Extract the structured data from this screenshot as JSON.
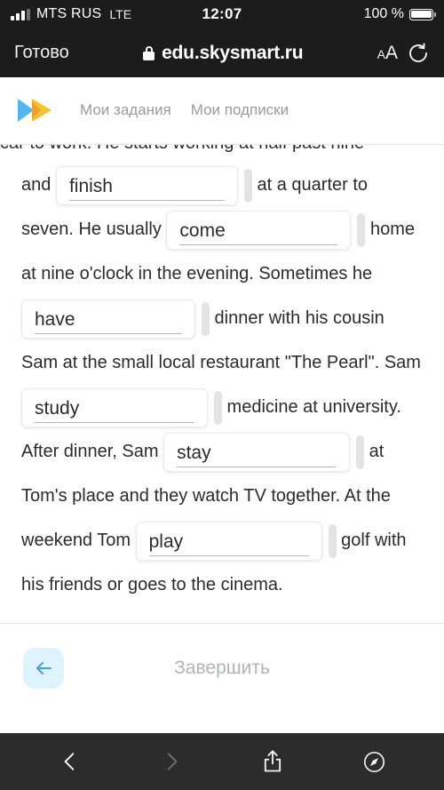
{
  "status_bar": {
    "carrier": "MTS RUS",
    "network": "LTE",
    "time": "12:07",
    "battery_percent": "100 %",
    "signal_bars_filled": 3,
    "signal_bars_total": 4
  },
  "browser": {
    "done_label": "Готово",
    "url": "edu.skysmart.ru",
    "lock_icon": "lock-icon",
    "text_size_label_small": "A",
    "text_size_label_large": "A",
    "reload_icon": "reload-icon"
  },
  "app_header": {
    "logo_icon": "skysmart-logo",
    "logo_colors": {
      "blue": "#53b6ef",
      "yellow": "#f5c842",
      "orange": "#f0a030"
    },
    "tabs": [
      {
        "label": "Мои задания",
        "name": "tab-my-assignments"
      },
      {
        "label": "Мои подписки",
        "name": "tab-my-subscriptions"
      }
    ],
    "tab_color": "#9b9b9b"
  },
  "exercise": {
    "clipped_line": "car to work. He starts working at half past nine",
    "segments": [
      {
        "type": "text",
        "value": "and "
      },
      {
        "type": "input",
        "value": "finish",
        "name": "answer-input-finish",
        "width_class": "w-finish"
      },
      {
        "type": "text",
        "value": " at a quarter to seven. He usually "
      },
      {
        "type": "input",
        "value": "come",
        "name": "answer-input-come",
        "width_class": "w-come"
      },
      {
        "type": "text",
        "value": " home at nine o'clock in the evening. Sometimes he "
      },
      {
        "type": "input",
        "value": "have",
        "name": "answer-input-have",
        "width_class": "w-have"
      },
      {
        "type": "text",
        "value": " dinner with his cousin Sam at the small local restaurant \"The Pearl\". Sam "
      },
      {
        "type": "input",
        "value": "study",
        "name": "answer-input-study",
        "width_class": "w-study"
      },
      {
        "type": "text",
        "value": " medicine at university. After dinner, Sam "
      },
      {
        "type": "input",
        "value": "stay",
        "name": "answer-input-stay",
        "width_class": "w-stay"
      },
      {
        "type": "text",
        "value": " at Tom's place and they watch TV together. At the weekend Tom "
      },
      {
        "type": "input",
        "value": "play",
        "name": "answer-input-play",
        "width_class": "w-play"
      },
      {
        "type": "text",
        "value": " golf with his friends or goes to the cinema."
      }
    ]
  },
  "footer": {
    "back_icon": "arrow-left-icon",
    "back_bg_color": "#dff3fd",
    "back_arrow_color": "#4a9fd8",
    "finish_label": "Завершить",
    "finish_color": "#b0b3b8"
  },
  "bottom_toolbar": {
    "items": [
      {
        "name": "nav-back-button",
        "icon": "chevron-left-icon",
        "enabled": true
      },
      {
        "name": "nav-forward-button",
        "icon": "chevron-right-icon",
        "enabled": false
      },
      {
        "name": "share-button",
        "icon": "share-icon",
        "enabled": true
      },
      {
        "name": "tabs-button",
        "icon": "compass-icon",
        "enabled": true
      }
    ]
  }
}
